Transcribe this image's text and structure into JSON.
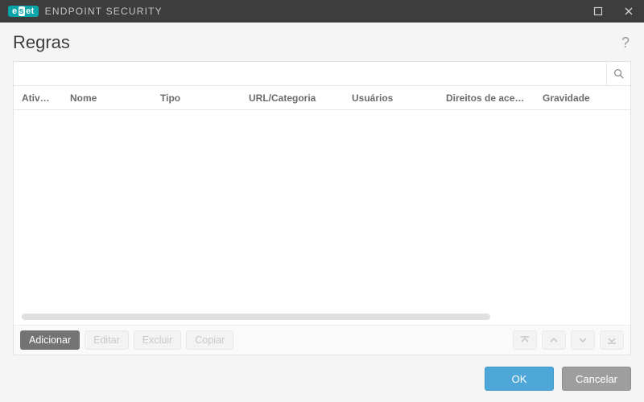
{
  "brand": {
    "badge_text": "eset",
    "product": "ENDPOINT SECURITY"
  },
  "page": {
    "title": "Regras"
  },
  "search": {
    "value": "",
    "placeholder": ""
  },
  "columns": {
    "c0": "Ativado",
    "c1": "Nome",
    "c2": "Tipo",
    "c3": "URL/Categoria",
    "c4": "Usuários",
    "c5": "Direitos de acesso",
    "c6": "Gravidade"
  },
  "rows": [],
  "toolbar": {
    "add": "Adicionar",
    "edit": "Editar",
    "delete": "Excluir",
    "copy": "Copiar"
  },
  "footer": {
    "ok": "OK",
    "cancel": "Cancelar"
  }
}
